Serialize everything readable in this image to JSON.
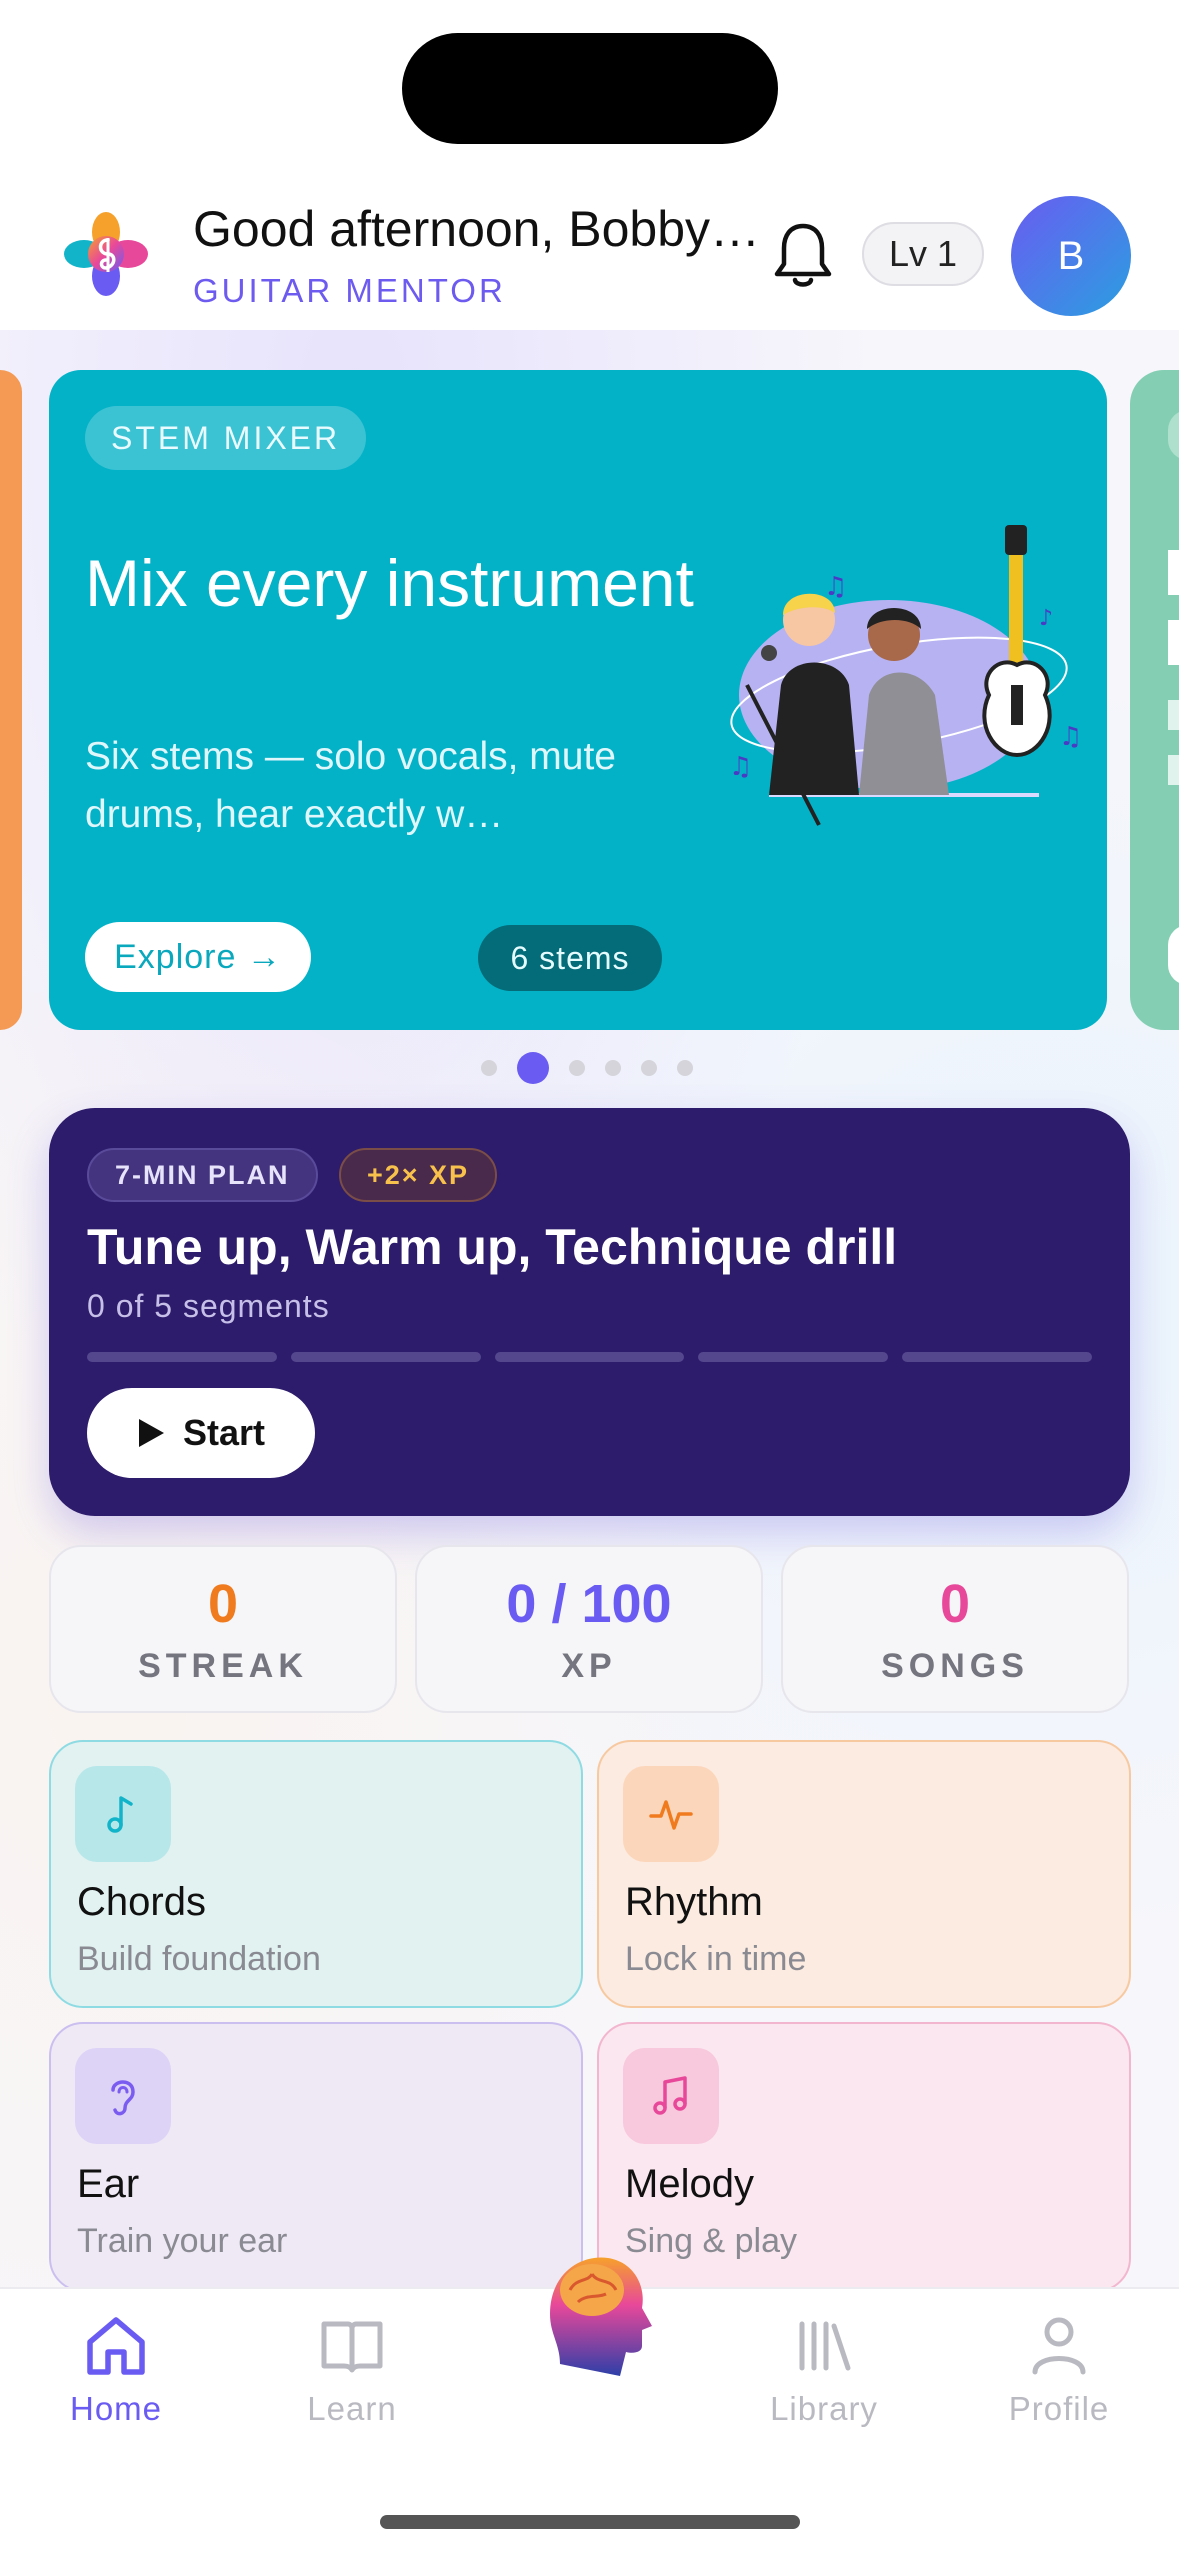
{
  "header": {
    "greeting": "Good afternoon, Bobby…",
    "subtitle": "GUITAR MENTOR",
    "level": "Lv 1",
    "avatar_initial": "B"
  },
  "carousel": {
    "active_index": 1,
    "dot_count": 6,
    "card": {
      "tag": "STEM MIXER",
      "title": "Mix every instrument",
      "description": "Six stems — solo vocals, mute drums, hear exactly w…",
      "cta": "Explore →",
      "badge": "6 stems",
      "color": "#04b2c8"
    }
  },
  "plan": {
    "tag": "7-MIN PLAN",
    "bonus": "+2× XP",
    "title": "Tune up, Warm up, Technique drill",
    "progress_text": "0 of 5 segments",
    "segments_total": 5,
    "segments_done": 0,
    "start_label": "Start"
  },
  "stats": [
    {
      "value": "0",
      "label": "STREAK",
      "color": "#f07b1f"
    },
    {
      "value": "0 / 100",
      "label": "XP",
      "color": "#6a5cf2"
    },
    {
      "value": "0",
      "label": "SONGS",
      "color": "#e8489a"
    }
  ],
  "skills": [
    {
      "name": "Chords",
      "desc": "Build foundation",
      "icon": "music-note-icon",
      "color": "#12b4c9"
    },
    {
      "name": "Rhythm",
      "desc": "Lock in time",
      "icon": "pulse-icon",
      "color": "#f07b1f"
    },
    {
      "name": "Ear",
      "desc": "Train your ear",
      "icon": "ear-icon",
      "color": "#7b5cf0"
    },
    {
      "name": "Melody",
      "desc": "Sing & play",
      "icon": "music-notes-icon",
      "color": "#e8489a"
    }
  ],
  "tabs": [
    {
      "label": "Home",
      "icon": "home-icon",
      "active": true
    },
    {
      "label": "Learn",
      "icon": "book-icon",
      "active": false
    },
    {
      "label": "Library",
      "icon": "library-icon",
      "active": false
    },
    {
      "label": "Profile",
      "icon": "person-icon",
      "active": false
    }
  ]
}
